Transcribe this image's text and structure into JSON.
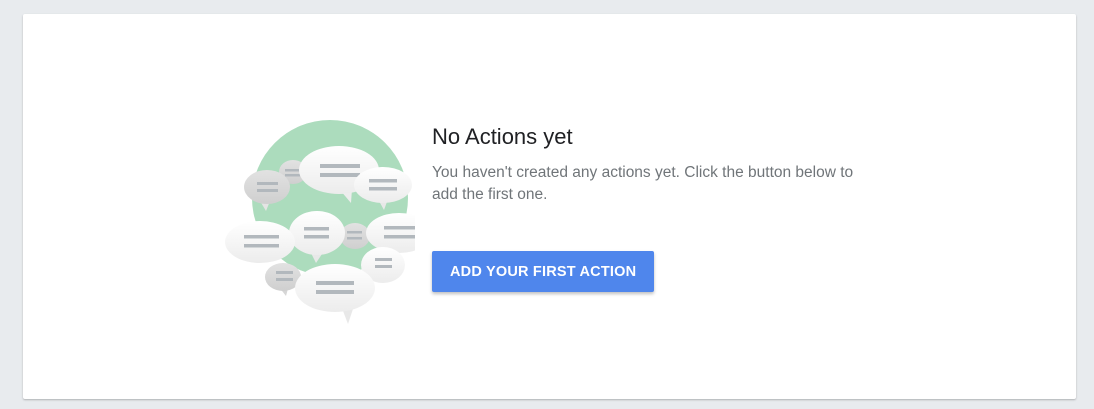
{
  "empty_state": {
    "title": "No Actions yet",
    "description": "You haven't created any actions yet. Click the button below to add the first one.",
    "button_label": "ADD YOUR FIRST ACTION",
    "illustration_icon": "chat-bubbles-illustration"
  },
  "colors": {
    "page_background": "#e8ebee",
    "card_background": "#ffffff",
    "primary_button": "#4f86ec",
    "illustration_circle": "#acdcbd",
    "title_text": "#202124",
    "body_text": "#707579"
  }
}
